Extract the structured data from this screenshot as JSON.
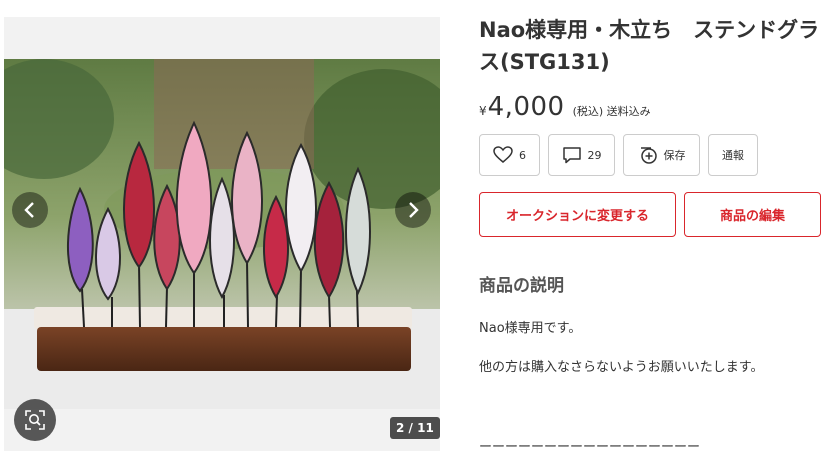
{
  "gallery": {
    "counter": "2 / 11",
    "prev_icon": "chevron-left-icon",
    "next_icon": "chevron-right-icon",
    "zoom_icon": "search-zoom-icon"
  },
  "item": {
    "title": "Nao様専用・木立ち　ステンドグラス(STG131)",
    "currency": "¥",
    "price": "4,000",
    "tax_note": "(税込) 送料込み"
  },
  "actions": {
    "like_count": "6",
    "comment_count": "29",
    "save_label": "保存",
    "report_label": "通報"
  },
  "buttons": {
    "auction": "オークションに変更する",
    "edit": "商品の編集"
  },
  "description": {
    "heading": "商品の説明",
    "line1": "Nao様専用です。",
    "line2": "他の方は購入なさらないようお願いいたします。",
    "line3": "ーーーーーーーーーーーーーーーーー"
  },
  "colors": {
    "accent": "#d9262c",
    "border": "#cccccc"
  }
}
